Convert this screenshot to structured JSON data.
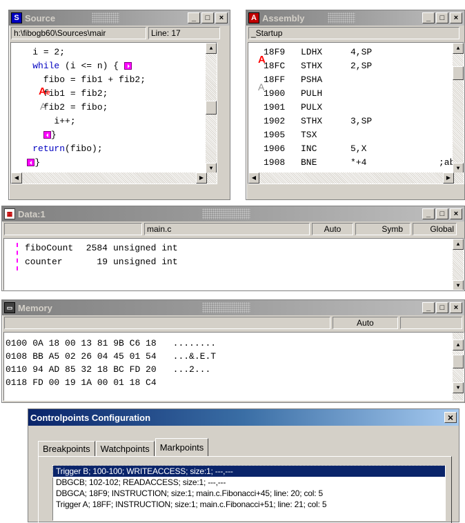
{
  "source": {
    "title": "Source",
    "file_path": "h:\\fibogb60\\Sources\\mair",
    "line_info": "Line: 17",
    "lines": [
      {
        "indent": "    ",
        "text": "i = 2;",
        "kw": ""
      },
      {
        "indent": "    ",
        "text": " (i <= n) {",
        "kw": "while"
      },
      {
        "indent": "      ",
        "text": "fibo = fib1 + fib2;",
        "kw": ""
      },
      {
        "indent": "      ",
        "text": "fib1 = fib2;",
        "kw": ""
      },
      {
        "indent": "      ",
        "text": "fib2 = fibo;",
        "kw": ""
      },
      {
        "indent": "        ",
        "text": "i++;",
        "kw": ""
      },
      {
        "indent": "      ",
        "text": "}",
        "kw": ""
      },
      {
        "indent": "    ",
        "text": "(fibo);",
        "kw": "return"
      },
      {
        "indent": "   ",
        "text": "}",
        "kw": ""
      }
    ],
    "bp_a": "A",
    "bp_a2": "A",
    "bp_e": "e"
  },
  "assembly": {
    "title": "Assembly",
    "procedure": "_Startup",
    "rows": [
      {
        "addr": "18F9",
        "op": "LDHX",
        "arg": "4,SP",
        "cmt": ""
      },
      {
        "addr": "18FC",
        "op": "STHX",
        "arg": "2,SP",
        "cmt": ""
      },
      {
        "addr": "18FF",
        "op": "PSHA",
        "arg": "",
        "cmt": ""
      },
      {
        "addr": "1900",
        "op": "PULH",
        "arg": "",
        "cmt": ""
      },
      {
        "addr": "1901",
        "op": "PULX",
        "arg": "",
        "cmt": ""
      },
      {
        "addr": "1902",
        "op": "STHX",
        "arg": "3,SP",
        "cmt": ""
      },
      {
        "addr": "1905",
        "op": "TSX",
        "arg": "",
        "cmt": ""
      },
      {
        "addr": "1906",
        "op": "INC",
        "arg": "5,X",
        "cmt": ""
      },
      {
        "addr": "1908",
        "op": "BNE",
        "arg": "*+4",
        "cmt": ";abs"
      }
    ],
    "bp_a": "A",
    "bp_a2": "A"
  },
  "data": {
    "title": "Data:1",
    "module": "main.c",
    "mode": "Auto",
    "format": "Symb",
    "scope": "Global",
    "vars": [
      {
        "name": "fiboCount",
        "value": "2584",
        "type": "unsigned int"
      },
      {
        "name": "counter",
        "value": "19",
        "type": "unsigned int"
      }
    ]
  },
  "memory": {
    "title": "Memory",
    "mode": "Auto",
    "rows": [
      {
        "addr": "0100",
        "bytes": "0A 18 00 13 81 9B C6 18",
        "ascii": "........"
      },
      {
        "addr": "0108",
        "bytes": "BB A5 02 26 04 45 01 54",
        "ascii": "...&.E.T"
      },
      {
        "addr": "0110",
        "bytes": "94 AD 85 32 18 BC FD 20",
        "ascii": "...2... "
      },
      {
        "addr": "0118",
        "bytes": "FD 00 19 1A 00 01 18 C4",
        "ascii": ""
      }
    ]
  },
  "controlpoints": {
    "title": "Controlpoints Configuration",
    "close": "×",
    "tabs": [
      "Breakpoints",
      "Watchpoints",
      "Markpoints"
    ],
    "items": [
      "Trigger B; 100-100; WRITEACCESS; size:1; ---,---",
      "DBGCB; 102-102; READACCESS; size:1; ---,---",
      "DBGCA; 18F9; INSTRUCTION; size:1; main.c.Fibonacci+45; line: 20; col: 5",
      "Trigger A; 18FF; INSTRUCTION; size:1; main.c.Fibonacci+51; line: 21; col: 5"
    ]
  },
  "window_buttons": {
    "min": "_",
    "max": "□",
    "close": "×"
  },
  "colors": {
    "keyword": "#0000c0",
    "breakpoint": "#ff0000",
    "mark": "#ff00ff",
    "selection": "#0a246a"
  }
}
